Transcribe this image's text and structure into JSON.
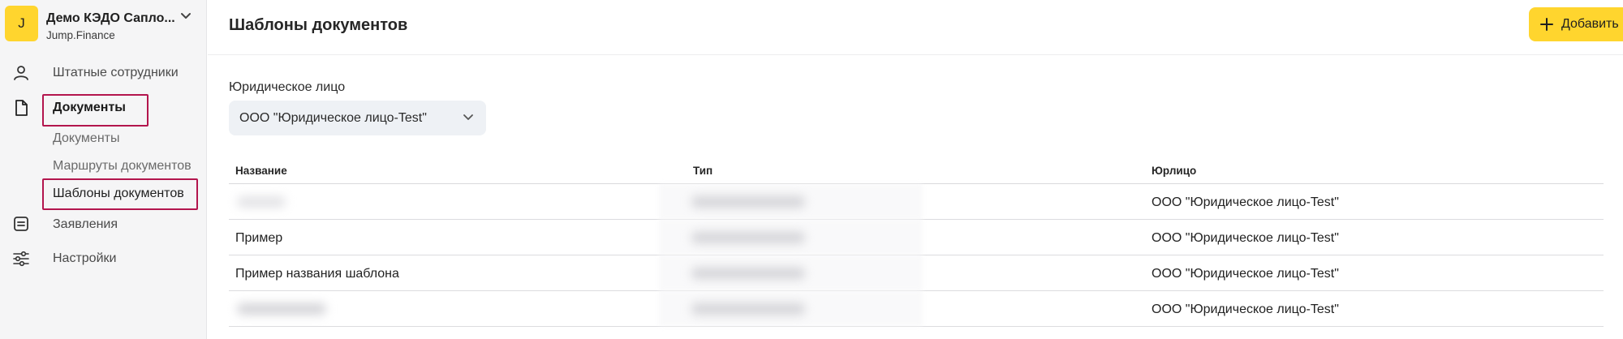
{
  "org": {
    "avatar_letter": "J",
    "name": "Демо КЭДО Сапло...",
    "subtitle": "Jump.Finance"
  },
  "sidebar": {
    "items": [
      {
        "label": "Штатные сотрудники",
        "icon": "person-icon"
      },
      {
        "label": "Документы",
        "icon": "document-icon"
      },
      {
        "label": "Заявления",
        "icon": "list-icon"
      },
      {
        "label": "Настройки",
        "icon": "sliders-icon"
      }
    ],
    "subitems": [
      {
        "label": "Документы"
      },
      {
        "label": "Маршруты документов"
      },
      {
        "label": "Шаблоны документов"
      }
    ]
  },
  "header": {
    "title": "Шаблоны документов",
    "add_label": "Добавить"
  },
  "filter": {
    "label": "Юридическое лицо",
    "value": "ООО \"Юридическое лицо-Test\""
  },
  "table": {
    "columns": [
      "Название",
      "Тип",
      "Юрлицо"
    ],
    "rows": [
      {
        "name": "",
        "type": "",
        "entity": "ООО \"Юридическое лицо-Test\""
      },
      {
        "name": "Пример",
        "type": "",
        "entity": "ООО \"Юридическое лицо-Test\""
      },
      {
        "name": "Пример названия шаблона",
        "type": "",
        "entity": "ООО \"Юридическое лицо-Test\""
      },
      {
        "name": "",
        "type": "",
        "entity": "ООО \"Юридическое лицо-Test\""
      }
    ]
  },
  "colors": {
    "accent": "#ffd52e",
    "highlight": "#b3154d",
    "select_bg": "#eef1f5",
    "sidebar_bg": "#f5f5f6"
  }
}
